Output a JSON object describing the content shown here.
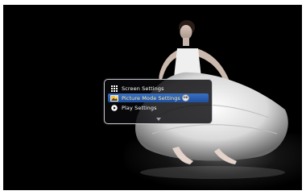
{
  "menu": {
    "items": [
      {
        "label": "Screen Settings",
        "icon": "grid-icon",
        "selected": false
      },
      {
        "label": "Picture Mode Settings",
        "icon": "picture-icon",
        "selected": true
      },
      {
        "label": "Play Settings",
        "icon": "play-icon",
        "selected": false
      }
    ],
    "ok_label": "OK"
  },
  "colors": {
    "background": "#000000",
    "highlight": "#2a5fb0",
    "menu_border": "#bfc3c8"
  }
}
